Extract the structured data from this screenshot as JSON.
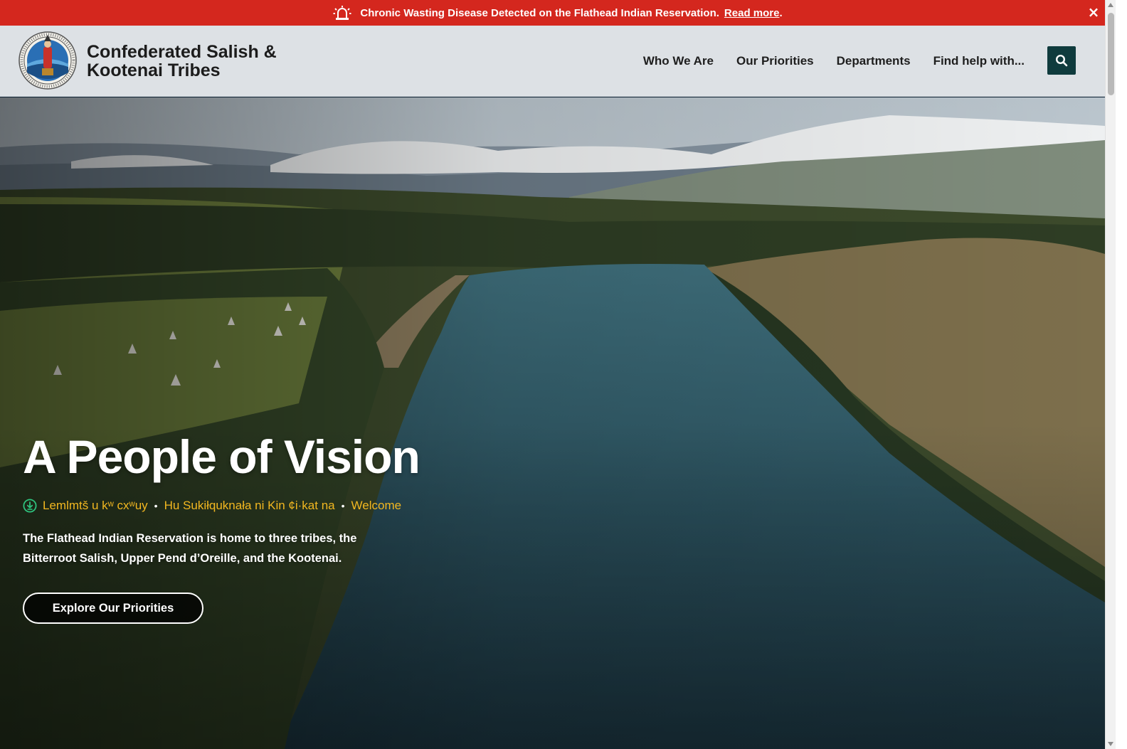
{
  "alert": {
    "text": "Chronic Wasting Disease Detected on the Flathead Indian Reservation.",
    "link_label": "Read more",
    "trailing": ".",
    "close_symbol": "×",
    "icon": "siren-icon",
    "background_color": "#d4271e"
  },
  "header": {
    "brand_name": "Confederated Salish & Kootenai Tribes",
    "logo": "tribal-seal",
    "nav": [
      "Who We Are",
      "Our Priorities",
      "Departments",
      "Find help with..."
    ],
    "search_icon": "search-icon",
    "search_button_color": "#0f3b3d"
  },
  "hero": {
    "title": "A People of Vision",
    "languages": {
      "audio_icon": "audio-play-icon",
      "items": [
        "Lemlmtš u kʷ cxʷuy",
        "Hu Sukiłquknała ni Kin ¢i·kat na",
        "Welcome"
      ],
      "separator": "•",
      "color": "#f2b720"
    },
    "description": "The Flathead Indian Reservation is home to three tribes, the Bitterroot Salish, Upper Pend d’Oreille, and the Kootenai.",
    "cta_label": "Explore Our Priorities"
  }
}
